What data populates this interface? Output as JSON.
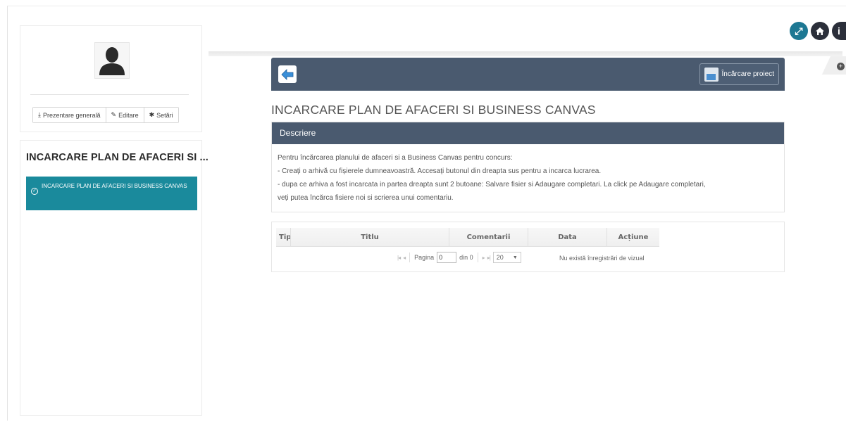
{
  "profile": {
    "tabs": [
      {
        "icon": "download-icon",
        "label": "Prezentare generală"
      },
      {
        "icon": "pencil-icon",
        "label": "Editare"
      },
      {
        "icon": "gear-icon",
        "label": "Setări"
      }
    ]
  },
  "menu": {
    "title": "INCARCARE PLAN DE AFACERI SI ...",
    "items": [
      {
        "label": "INCARCARE PLAN DE AFACERI SI BUSINESS CANVAS",
        "active": true
      }
    ]
  },
  "toolbar": {
    "upload_label": "Încărcare proiect"
  },
  "page": {
    "title": "INCARCARE PLAN DE AFACERI SI BUSINESS CANVAS"
  },
  "description": {
    "header": "Descriere",
    "lines": [
      "Pentru încărcarea planului de afaceri si a Business Canvas pentru concurs:",
      "- Creați o arhivă cu fișierele dumneavoastră. Accesați butonul din dreapta sus pentru a incarca lucrarea.",
      "- dupa ce arhiva a fost incarcata in partea dreapta sunt 2 butoane: Salvare fisier si Adaugare completari. La click pe Adaugare completari,",
      "veți putea încărca fisiere noi si scrierea unui comentariu."
    ]
  },
  "grid": {
    "columns": [
      "Tip",
      "Titlu",
      "Comentarii",
      "Data",
      "Acțiune"
    ],
    "pager": {
      "page_label": "Pagina",
      "page_value": "0",
      "of_label": "din 0",
      "page_size": "20"
    },
    "empty_message": "Nu există înregistrări de vizual"
  },
  "colors": {
    "header_bg": "#4a5a6f",
    "active_menu": "#1a8a9c",
    "icon_teal": "#1d7893"
  }
}
